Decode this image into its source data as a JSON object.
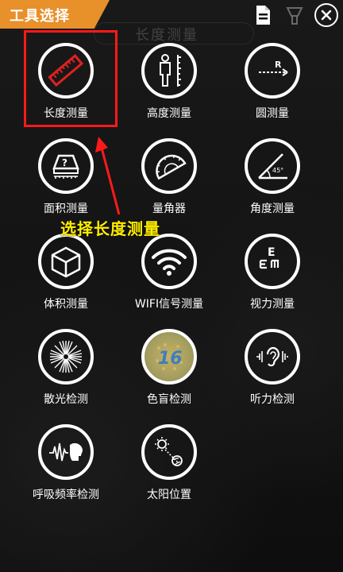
{
  "header": {
    "title": "工具选择",
    "background_title": "长度测量"
  },
  "tools": [
    {
      "label": "长度测量",
      "icon": "ruler-icon"
    },
    {
      "label": "高度测量",
      "icon": "person-height-icon"
    },
    {
      "label": "圆测量",
      "icon": "circle-radius-icon"
    },
    {
      "label": "面积测量",
      "icon": "area-box-icon"
    },
    {
      "label": "量角器",
      "icon": "protractor-icon"
    },
    {
      "label": "角度测量",
      "icon": "angle-45-icon"
    },
    {
      "label": "体积测量",
      "icon": "cube-volume-icon"
    },
    {
      "label": "WIFI信号测量",
      "icon": "wifi-icon"
    },
    {
      "label": "视力测量",
      "icon": "eye-chart-icon"
    },
    {
      "label": "散光检测",
      "icon": "astigmatism-icon"
    },
    {
      "label": "色盲检测",
      "icon": "color-blind-plate-icon"
    },
    {
      "label": "听力检测",
      "icon": "ear-icon"
    },
    {
      "label": "呼吸频率检测",
      "icon": "breath-icon"
    },
    {
      "label": "太阳位置",
      "icon": "sun-position-icon"
    }
  ],
  "circle_icon_text": {
    "radius": "R",
    "angle": "45°",
    "eye_chart": "E",
    "plate_number": "16",
    "area_question": "?"
  },
  "annotation": "选择长度测量",
  "colors": {
    "accent": "#e8902a",
    "highlight": "#ff1a1a",
    "annotation": "#ffee00",
    "ruler": "#e02020"
  }
}
